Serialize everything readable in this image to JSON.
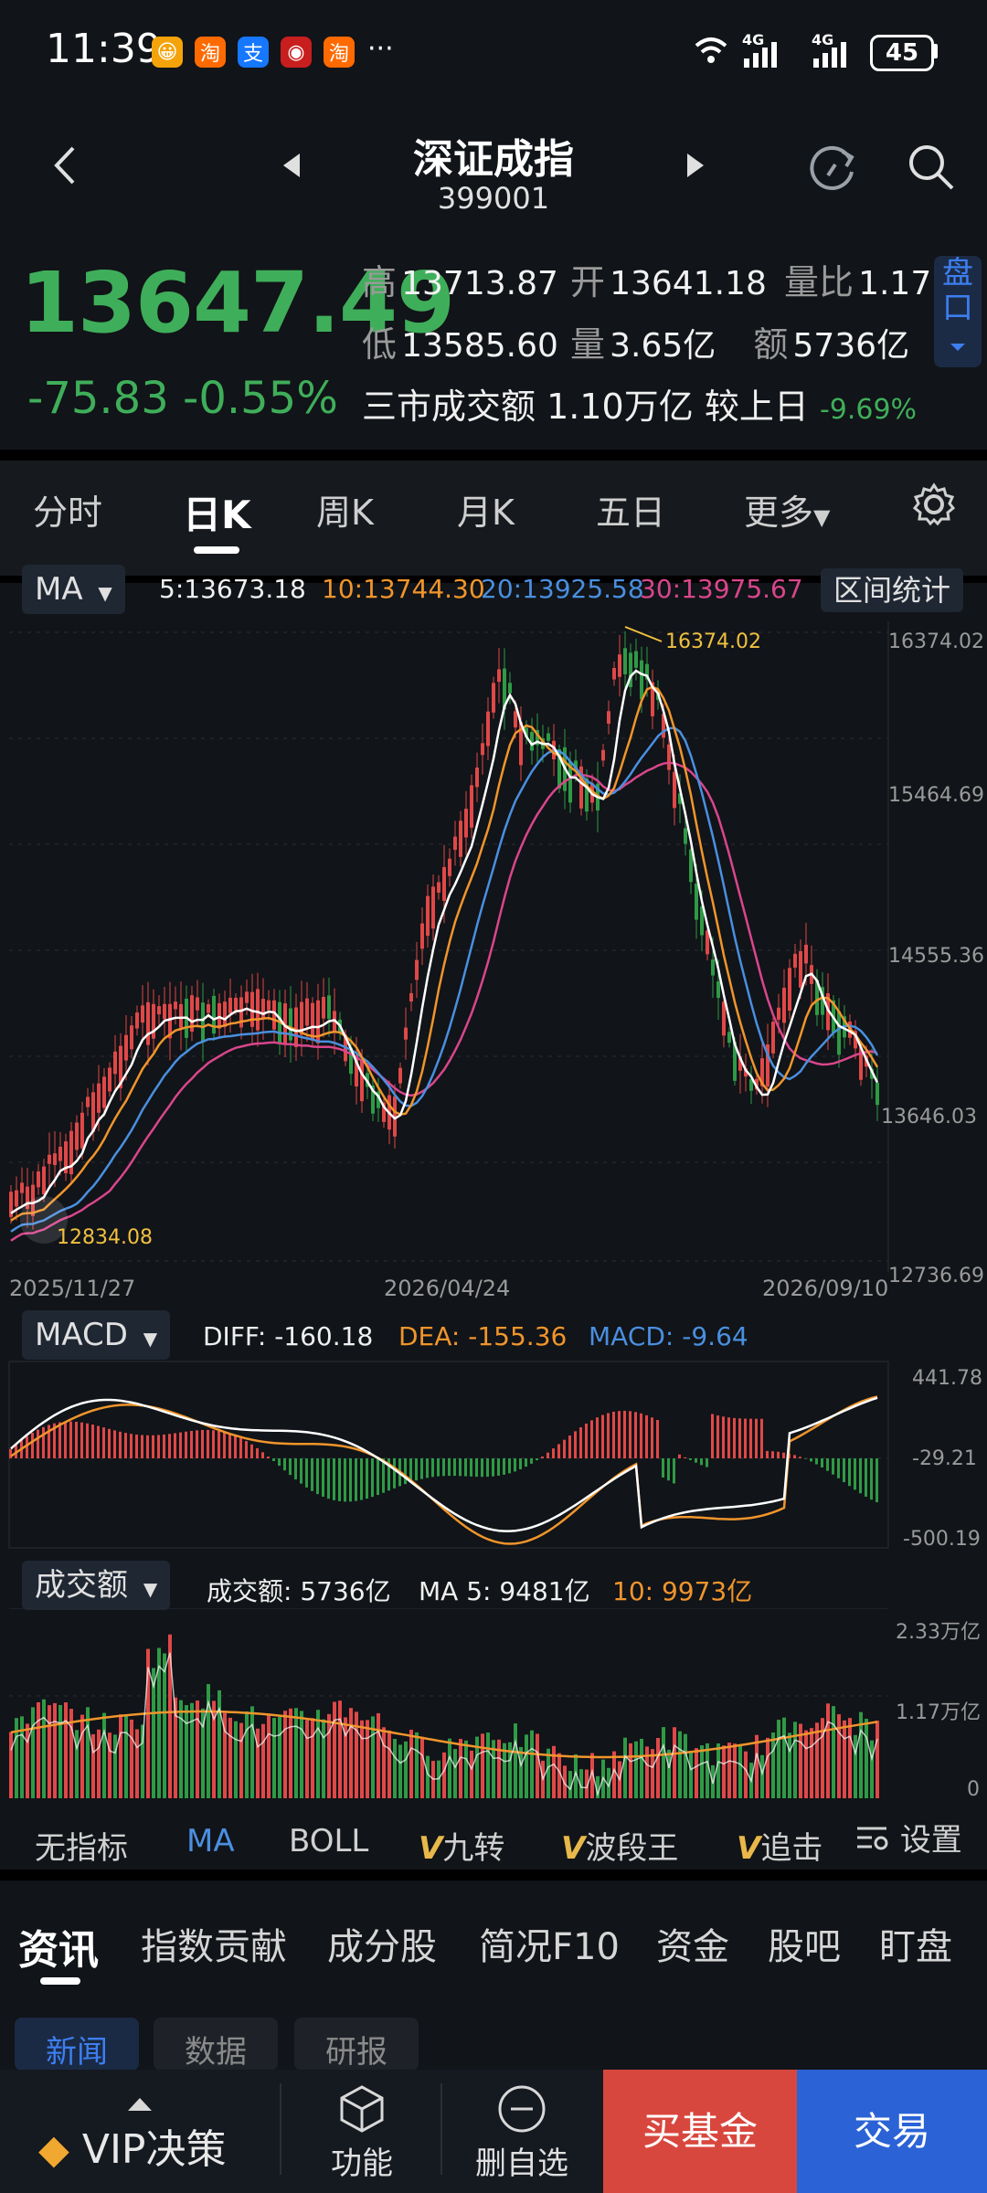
{
  "status": {
    "time": "11:39",
    "apps": [
      {
        "icon": "app-orange-icon",
        "label": "😀",
        "color": "#f5a30a"
      },
      {
        "icon": "taobao-icon",
        "label": "淘",
        "color": "#ff6a00"
      },
      {
        "icon": "alipay-icon",
        "label": "支",
        "color": "#1677ff"
      },
      {
        "icon": "app-red-icon",
        "label": "◉",
        "color": "#c81e1e"
      },
      {
        "icon": "taobao-icon",
        "label": "淘",
        "color": "#ff6a00"
      }
    ],
    "more": "···",
    "net1": "4G",
    "net2": "4G",
    "battery": "45"
  },
  "header": {
    "title": "深证成指",
    "code": "399001"
  },
  "quote": {
    "price": "13647.49",
    "change": "-75.83",
    "change_pct": "-0.55%",
    "high_label": "高",
    "high": "13713.87",
    "open_label": "开",
    "open": "13641.18",
    "ratio_label": "量比",
    "ratio": "1.17",
    "low_label": "低",
    "low": "13585.60",
    "vol_label": "量",
    "vol": "3.65亿",
    "amt_label": "额",
    "amt": "5736亿",
    "market_label": "三市成交额",
    "market_amt": "1.10万亿",
    "prev_label": "较上日",
    "prev_pct": "-9.69%",
    "pankou_top": "盘",
    "pankou_bottom": "口"
  },
  "tabs": [
    "分时",
    "日K",
    "周K",
    "月K",
    "五日",
    "更多"
  ],
  "active_tab": "日K",
  "ma_row": {
    "selector": "MA",
    "ma5": "5:13673.18",
    "ma10": "10:13744.30",
    "ma20": "20:13925.58",
    "ma30": "30:13975.67",
    "range_btn": "区间统计"
  },
  "colors": {
    "up": "#e04848",
    "down": "#2f9a46",
    "ma5": "#ffffff",
    "ma10": "#f0952c",
    "ma20": "#4a8fe0",
    "ma30": "#d9468c"
  },
  "kline": {
    "y_ticks": [
      "16374.02",
      "15464.69",
      "14555.36",
      "13646.03",
      "12736.69"
    ],
    "max_label": "16374.02",
    "min_label": "12834.08",
    "dates": [
      "2025/11/27",
      "2026/04/24",
      "2026/09/10"
    ]
  },
  "macd": {
    "selector": "MACD",
    "diff": "DIFF: -160.18",
    "dea": "DEA: -155.36",
    "macd": "MACD: -9.64",
    "y_ticks": [
      "441.78",
      "-29.21",
      "-500.19"
    ]
  },
  "volume": {
    "selector": "成交额",
    "amt": "成交额: 5736亿",
    "ma5": "MA 5: 9481亿",
    "ma10": "10: 9973亿",
    "y_ticks": [
      "2.33万亿",
      "1.17万亿",
      "0"
    ]
  },
  "indicators": [
    "无指标",
    "MA",
    "BOLL",
    "九转",
    "波段王",
    "追击",
    "设置"
  ],
  "info_tabs": [
    "资讯",
    "指数贡献",
    "成分股",
    "简况F10",
    "资金",
    "股吧",
    "盯盘"
  ],
  "sub_tabs": [
    "新闻",
    "数据",
    "研报"
  ],
  "bottom": {
    "vip": "VIP决策",
    "func": "功能",
    "del": "删自选",
    "buy": "买基金",
    "trade": "交易"
  }
}
